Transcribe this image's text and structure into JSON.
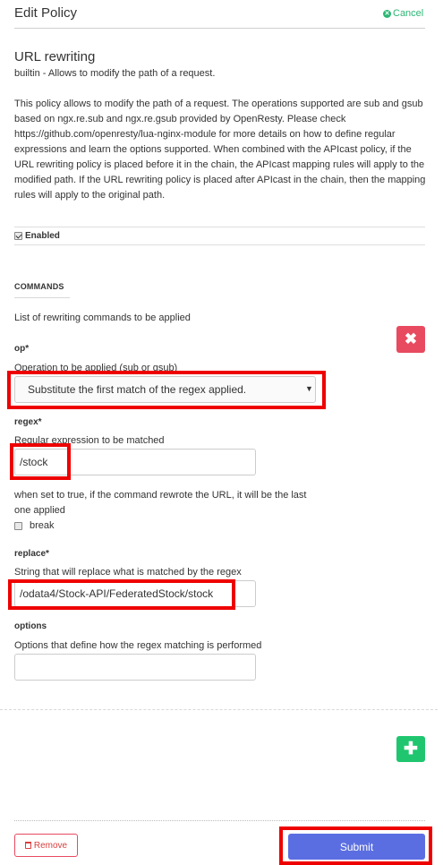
{
  "header": {
    "title": "Edit Policy",
    "cancel_label": "Cancel"
  },
  "policy": {
    "name": "URL rewriting",
    "summary": "builtin - Allows to modify the path of a request.",
    "description": "This policy allows to modify the path of a request. The operations supported are sub and gsub based on ngx.re.sub and ngx.re.gsub provided by OpenResty. Please check https://github.com/openresty/lua-nginx-module for more details on how to define regular expressions and learn the options supported. When combined with the APIcast policy, if the URL rewriting policy is placed before it in the chain, the APIcast mapping rules will apply to the modified path. If the URL rewriting policy is placed after APIcast in the chain, then the mapping rules will apply to the original path.",
    "enabled_label": "Enabled",
    "enabled": true
  },
  "commands": {
    "title": "COMMANDS",
    "description": "List of rewriting commands to be applied",
    "op": {
      "label": "op*",
      "help": "Operation to be applied (sub or gsub)",
      "selected": "Substitute the first match of the regex applied."
    },
    "regex": {
      "label": "regex*",
      "help": "Regular expression to be matched",
      "value": "/stock"
    },
    "break": {
      "help": "when set to true, if the command rewrote the URL, it will be the last one applied",
      "label": "break",
      "checked": false
    },
    "replace": {
      "label": "replace*",
      "help": "String that will replace what is matched by the regex",
      "value": "/odata4/Stock-API/FederatedStock/stock"
    },
    "options": {
      "label": "options",
      "help": "Options that define how the regex matching is performed",
      "value": ""
    }
  },
  "footer": {
    "remove_label": "Remove",
    "submit_label": "Submit"
  },
  "colors": {
    "accent_green": "#2bb673",
    "danger_red": "#e84a5f",
    "submit_blue": "#5b6ee1",
    "annotation_red": "#ee0000"
  }
}
